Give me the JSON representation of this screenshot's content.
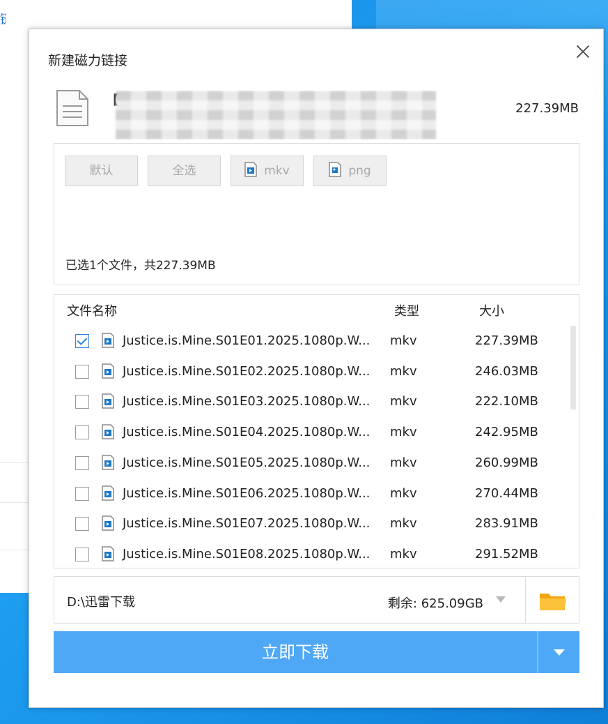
{
  "dialog": {
    "title": "新建磁力链接",
    "torrent": {
      "name_prefix": "【",
      "size": "227.39MB"
    }
  },
  "filters": {
    "default_label": "默认",
    "select_all_label": "全选",
    "type_mkv_label": "mkv",
    "type_png_label": "png"
  },
  "summary": "已选1个文件，共227.39MB",
  "list": {
    "headers": {
      "name": "文件名称",
      "type": "类型",
      "size": "大小"
    },
    "files": [
      {
        "name": "Justice.is.Mine.S01E01.2025.1080p.W...",
        "type": "mkv",
        "size": "227.39MB",
        "checked": true
      },
      {
        "name": "Justice.is.Mine.S01E02.2025.1080p.W...",
        "type": "mkv",
        "size": "246.03MB",
        "checked": false
      },
      {
        "name": "Justice.is.Mine.S01E03.2025.1080p.W...",
        "type": "mkv",
        "size": "222.10MB",
        "checked": false
      },
      {
        "name": "Justice.is.Mine.S01E04.2025.1080p.W...",
        "type": "mkv",
        "size": "242.95MB",
        "checked": false
      },
      {
        "name": "Justice.is.Mine.S01E05.2025.1080p.W...",
        "type": "mkv",
        "size": "260.99MB",
        "checked": false
      },
      {
        "name": "Justice.is.Mine.S01E06.2025.1080p.W...",
        "type": "mkv",
        "size": "270.44MB",
        "checked": false
      },
      {
        "name": "Justice.is.Mine.S01E07.2025.1080p.W...",
        "type": "mkv",
        "size": "283.91MB",
        "checked": false
      },
      {
        "name": "Justice.is.Mine.S01E08.2025.1080p.W...",
        "type": "mkv",
        "size": "291.52MB",
        "checked": false
      }
    ]
  },
  "save": {
    "path": "D:\\迅雷下载",
    "free_space": "剩余: 625.09GB"
  },
  "download_label": "立即下载",
  "icons": {
    "close": "close-icon",
    "document": "document-icon",
    "video_file": "video-file-icon",
    "image_file": "image-file-icon",
    "folder": "folder-icon",
    "dropdown": "chevron-down-icon"
  },
  "colors": {
    "accent": "#4fa8f5",
    "checkbox": "#2f7fe0",
    "folder": "#f6b21c"
  }
}
